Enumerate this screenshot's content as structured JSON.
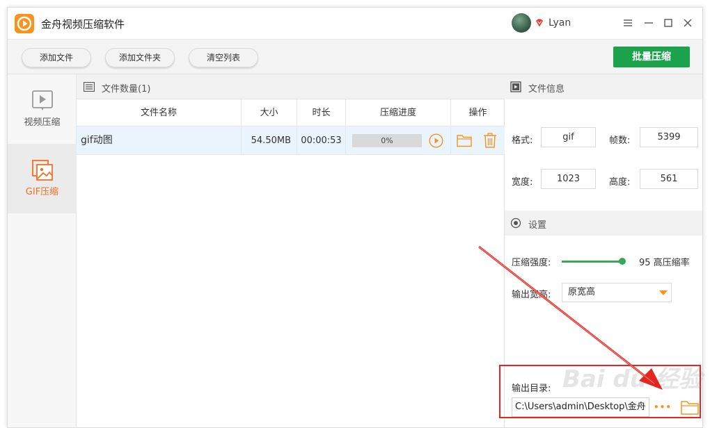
{
  "window": {
    "title": "金舟视频压缩软件",
    "username": "Lyan"
  },
  "toolbar": {
    "add_file": "添加文件",
    "add_folder": "添加文件夹",
    "clear_list": "清空列表",
    "batch_compress": "批量压缩"
  },
  "nav": {
    "video_label": "视频压缩",
    "gif_label": "GIF压缩"
  },
  "list": {
    "header_label": "文件数量",
    "file_count": "(1)",
    "columns": {
      "name": "文件名称",
      "size": "大小",
      "duration": "时长",
      "progress": "压缩进度",
      "actions": "操作"
    },
    "rows": [
      {
        "name": "gif动图",
        "size": "54.50MB",
        "duration": "00:00:53",
        "progress_text": "0%",
        "progress_value": 0
      }
    ]
  },
  "file_info": {
    "header": "文件信息",
    "format_label": "格式:",
    "format": "gif",
    "frames_label": "帧数:",
    "frames": "5399",
    "width_label": "宽度:",
    "width": "1023",
    "height_label": "高度:",
    "height": "561"
  },
  "settings": {
    "header": "设置",
    "strength_label": "压缩强度:",
    "strength_value": 95,
    "strength_text": "95 高压缩率",
    "size_label": "输出宽高:",
    "size_selected": "原宽高",
    "output_dir_label": "输出目录:",
    "output_dir": "C:\\Users\\admin\\Desktop\\金舟",
    "more_label": "•••"
  },
  "watermark": "Bai du 经验",
  "colors": {
    "accent_green": "#1aa34a",
    "accent_orange": "#f07027",
    "annotation_red": "#e5251f"
  }
}
